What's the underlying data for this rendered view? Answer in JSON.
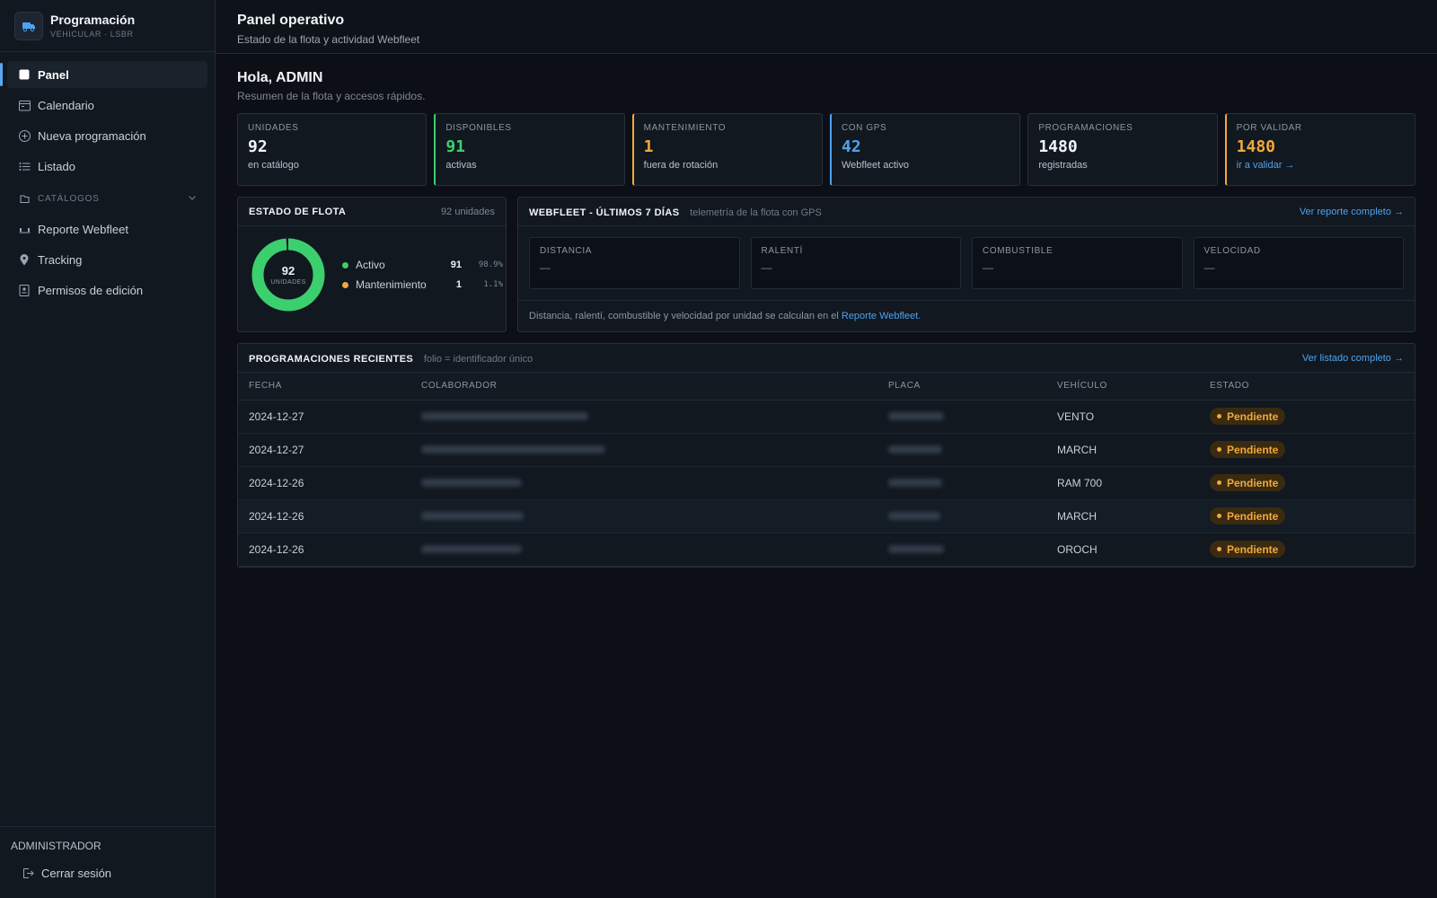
{
  "brand": {
    "title": "Programación",
    "subtitle": "VEHICULAR · LSBR",
    "icon": "truck-icon"
  },
  "nav": {
    "items": [
      {
        "label": "Panel",
        "icon": "dashboard-icon",
        "active": true
      },
      {
        "label": "Calendario",
        "icon": "calendar-icon"
      },
      {
        "label": "Nueva programación",
        "icon": "plus-circle-icon"
      },
      {
        "label": "Listado",
        "icon": "list-icon"
      }
    ],
    "section_label": "CATÁLOGOS",
    "section_items": [
      {
        "label": "Reporte Webfleet",
        "icon": "truck-report-icon"
      },
      {
        "label": "Tracking",
        "icon": "map-pin-icon"
      },
      {
        "label": "Permisos de edición",
        "icon": "permissions-icon"
      }
    ]
  },
  "user": {
    "role": "ADMINISTRADOR",
    "logout_label": "Cerrar sesión"
  },
  "header": {
    "title": "Panel operativo",
    "subtitle": "Estado de la flota y actividad Webfleet"
  },
  "greeting": {
    "title": "Hola, ADMIN",
    "subtitle": "Resumen de la flota y accesos rápidos."
  },
  "kpis": [
    {
      "label": "UNIDADES",
      "value": "92",
      "sub": "en catálogo"
    },
    {
      "label": "DISPONIBLES",
      "value": "91",
      "sub": "activas",
      "color": "#3ccf6e"
    },
    {
      "label": "MANTENIMIENTO",
      "value": "1",
      "sub": "fuera de rotación",
      "color": "#f0a93c"
    },
    {
      "label": "CON GPS",
      "value": "42",
      "sub": "Webfleet activo",
      "color": "#4ea3f0"
    },
    {
      "label": "PROGRAMACIONES",
      "value": "1480",
      "sub": "registradas"
    },
    {
      "label": "POR VALIDAR",
      "value": "1480",
      "link": "ir a validar →",
      "color": "#f0a93c"
    }
  ],
  "fleet": {
    "title": "ESTADO DE FLOTA",
    "total_label": "92 unidades",
    "center_value": "92",
    "center_label": "UNIDADES",
    "legend": [
      {
        "name": "Activo",
        "count": "91",
        "pct": "98.9%",
        "color": "#3ccf6e"
      },
      {
        "name": "Mantenimiento",
        "count": "1",
        "pct": "1.1%",
        "color": "#f0a93c"
      }
    ]
  },
  "webfleet": {
    "title": "WEBFLEET - ÚLTIMOS 7 DÍAS",
    "note": "telemetría de la flota con GPS",
    "link": "Ver reporte completo →",
    "metrics": [
      {
        "label": "DISTANCIA",
        "value": "—"
      },
      {
        "label": "RALENTÍ",
        "value": "—"
      },
      {
        "label": "COMBUSTIBLE",
        "value": "—"
      },
      {
        "label": "VELOCIDAD",
        "value": "—"
      }
    ],
    "footer_text": "Distancia, ralentí, combustible y velocidad por unidad se calculan en el",
    "footer_link": "Reporte Webfleet",
    "footer_end": "."
  },
  "recent": {
    "title": "PROGRAMACIONES RECIENTES",
    "note": "folio = identificador único",
    "link": "Ver listado completo →",
    "columns": [
      "FECHA",
      "COLABORADOR",
      "PLACA",
      "VEHÍCULO",
      "ESTADO"
    ],
    "rows": [
      {
        "fecha": "2024-12-27",
        "vehiculo": "VENTO",
        "estado": "Pendiente"
      },
      {
        "fecha": "2024-12-27",
        "vehiculo": "MARCH",
        "estado": "Pendiente"
      },
      {
        "fecha": "2024-12-26",
        "vehiculo": "RAM 700",
        "estado": "Pendiente"
      },
      {
        "fecha": "2024-12-26",
        "vehiculo": "MARCH",
        "estado": "Pendiente"
      },
      {
        "fecha": "2024-12-26",
        "vehiculo": "OROCH",
        "estado": "Pendiente"
      }
    ]
  }
}
